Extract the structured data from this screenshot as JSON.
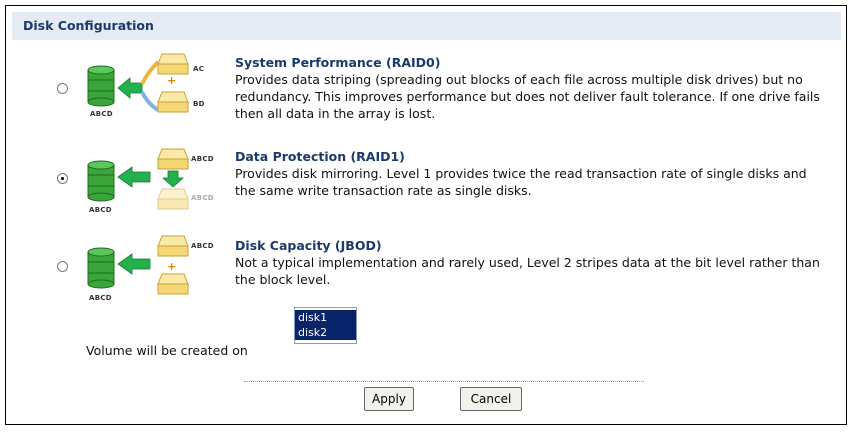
{
  "header": {
    "title": "Disk Configuration"
  },
  "options": [
    {
      "title": "System Performance (RAID0)",
      "description": "Provides data striping (spreading out blocks of each file across multiple disk drives) but no redundancy. This improves performance but does not deliver fault tolerance. If one drive fails then all data in the array is lost.",
      "selected": false,
      "labels": {
        "main": "ABCD",
        "top": "AC",
        "bottom": "BD"
      }
    },
    {
      "title": "Data Protection (RAID1)",
      "description": "Provides disk mirroring. Level 1 provides twice the read transaction rate of single disks and the same write transaction rate as single disks.",
      "selected": true,
      "labels": {
        "main": "ABCD",
        "top": "ABCD",
        "bottom": "ABCD"
      }
    },
    {
      "title": "Disk Capacity (JBOD)",
      "description": "Not a typical implementation and rarely used, Level 2 stripes data at the bit level rather than the block level.",
      "selected": false,
      "labels": {
        "main": "ABCD",
        "top": "ABCD"
      }
    }
  ],
  "volume": {
    "label": "Volume will be created on",
    "disks": [
      "disk1",
      "disk2"
    ]
  },
  "buttons": {
    "apply": "Apply",
    "cancel": "Cancel"
  },
  "colors": {
    "header_bg": "#e4ebf5",
    "title_color": "#1b3a6b",
    "selection_bg": "#0a246a",
    "disk_green": "#3aa63a",
    "arrow_green": "#22b14c",
    "arrow_blue": "#7fb2e5",
    "drive_yellow": "#f5d774"
  }
}
